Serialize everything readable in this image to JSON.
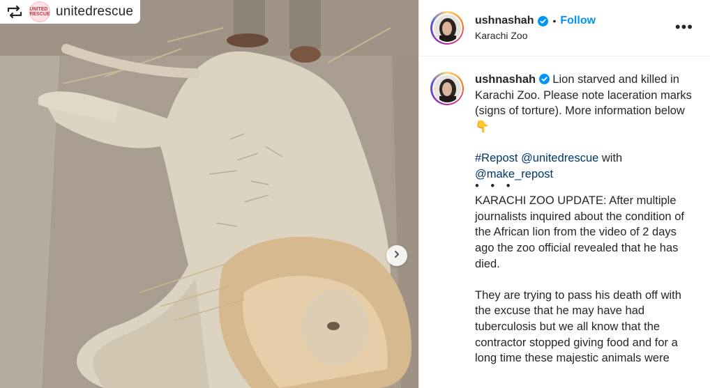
{
  "media": {
    "repost_source": "unitedrescue",
    "repost_avatar_text": "UNITED RESCUE"
  },
  "header": {
    "username": "ushnashah",
    "separator": "•",
    "follow_label": "Follow",
    "location": "Karachi Zoo",
    "more_label": "•••"
  },
  "caption": {
    "username": "ushnashah",
    "text1": "Lion starved and killed in Karachi Zoo. Please note laceration marks (signs of torture). More information below 👇",
    "repost_hashtag": "#Repost",
    "repost_mention": "@unitedrescue",
    "with_word": "with",
    "make_repost_mention": "@make_repost",
    "dots": "• • •",
    "paragraph1": "KARACHI ZOO UPDATE: After multiple journalists inquired about the condition of the African lion from the video of 2 days ago the zoo official revealed that he has died.",
    "paragraph2": "They are trying to pass his death off with the excuse that he may have had tuberculosis but we all know that the contractor stopped giving food and for a long time these majestic animals were"
  },
  "colors": {
    "link": "#00376b",
    "follow": "#0095f6",
    "verified": "#0095f6"
  },
  "icons": [
    "repost-icon",
    "verified-badge-icon",
    "more-options-icon",
    "chevron-right-icon"
  ]
}
